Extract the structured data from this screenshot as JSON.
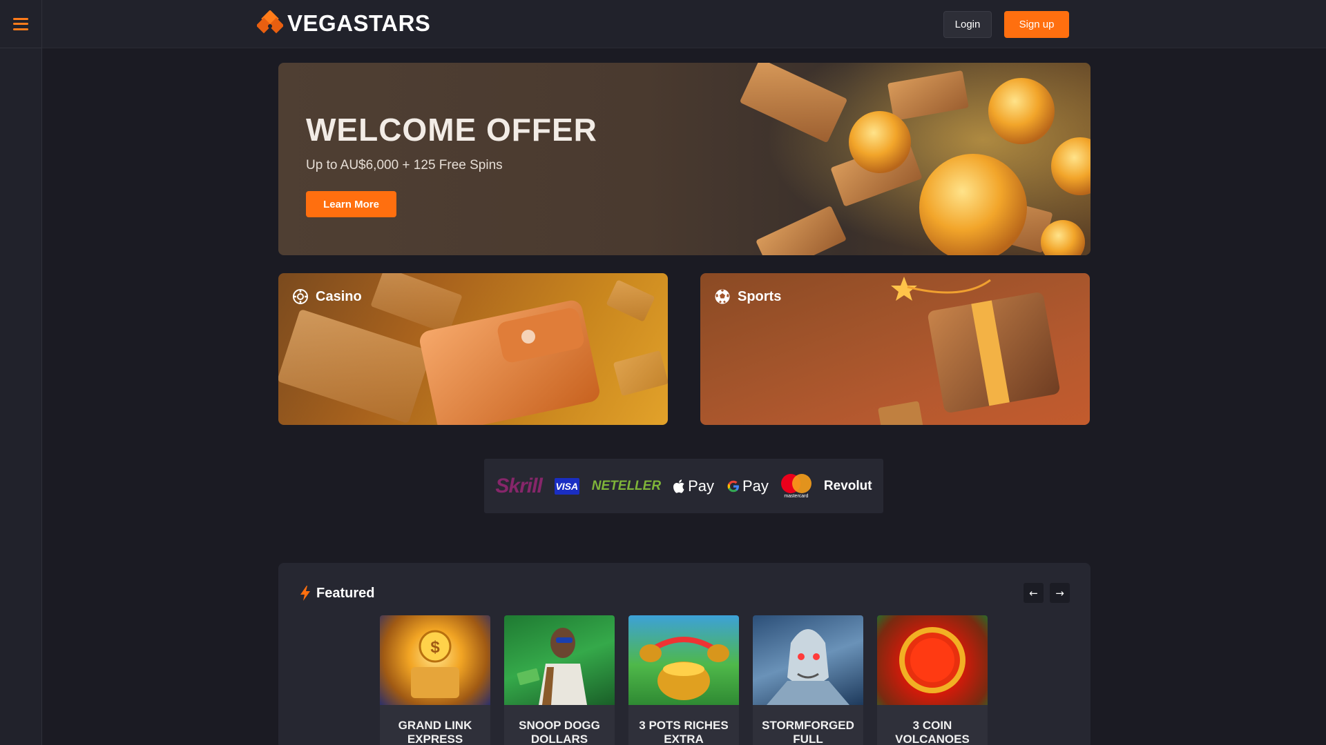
{
  "header": {
    "brand": "VEGASTARS",
    "login_label": "Login",
    "signup_label": "Sign up"
  },
  "sidebar": {
    "menu_icon": "hamburger-menu-icon"
  },
  "hero": {
    "title": "WELCOME OFFER",
    "subtitle": "Up to AU$6,000 + 125 Free Spins",
    "cta_label": "Learn More"
  },
  "categories": [
    {
      "label": "Casino",
      "icon": "casino-chip-icon"
    },
    {
      "label": "Sports",
      "icon": "soccer-ball-icon"
    }
  ],
  "payments": {
    "skrill": "Skrill",
    "visa": "VISA",
    "neteller": "NETELLER",
    "apple_pay": "Pay",
    "google_pay": "Pay",
    "mastercard": "mastercard",
    "revolut": "Revolut"
  },
  "featured": {
    "title": "Featured",
    "icon": "lightning-bolt-icon",
    "prev_label": "←",
    "next_label": "→",
    "games": [
      {
        "title": "GRAND LINK EXPRESS"
      },
      {
        "title": "SNOOP DOGG DOLLARS"
      },
      {
        "title": "3 POTS RICHES EXTRA"
      },
      {
        "title": "STORMFORGED FULL"
      },
      {
        "title": "3 COIN VOLCANOES"
      }
    ]
  },
  "colors": {
    "accent": "#ff6f0f",
    "background": "#1b1b23",
    "header_bg": "#21222b",
    "panel_bg": "#262731"
  }
}
